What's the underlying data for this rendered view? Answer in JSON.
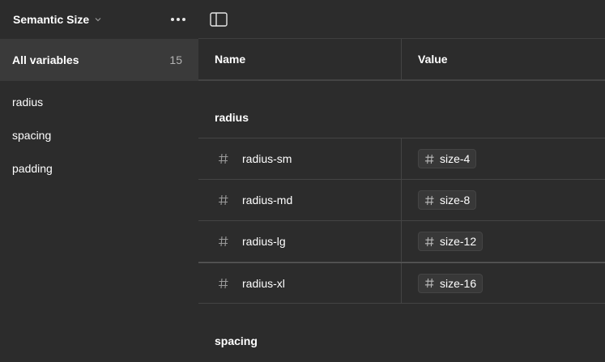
{
  "sidebar": {
    "collection_title": "Semantic Size",
    "all_variables": {
      "label": "All variables",
      "count": "15"
    },
    "groups": [
      {
        "label": "radius"
      },
      {
        "label": "spacing"
      },
      {
        "label": "padding"
      }
    ]
  },
  "table": {
    "headers": {
      "name": "Name",
      "value": "Value"
    },
    "groups": [
      {
        "title": "radius",
        "rows": [
          {
            "name": "radius-sm",
            "value": "size-4"
          },
          {
            "name": "radius-md",
            "value": "size-8"
          },
          {
            "name": "radius-lg",
            "value": "size-12"
          },
          {
            "name": "radius-xl",
            "value": "size-16"
          }
        ]
      },
      {
        "title": "spacing",
        "rows": []
      }
    ]
  },
  "icons": {
    "chevron": "chevron-down-icon",
    "more": "more-horizontal-icon",
    "panel": "sidebar-panel-icon",
    "number": "hash-icon"
  },
  "colors": {
    "background": "#2c2c2c",
    "selected_row": "#3a3a3a",
    "divider": "#444444",
    "chip_bg": "#383838"
  }
}
